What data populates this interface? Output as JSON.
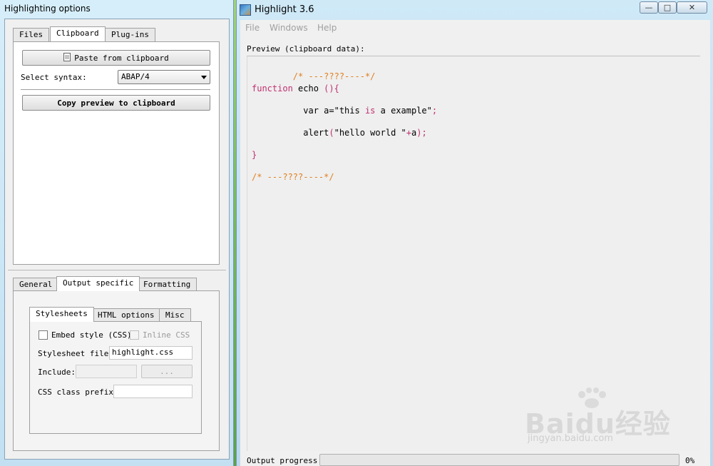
{
  "left_window": {
    "title": "Highlighting options",
    "top_tabs": [
      "Files",
      "Clipboard",
      "Plug-ins"
    ],
    "active_top_tab": "Clipboard",
    "clipboard": {
      "paste_button": "Paste from clipboard",
      "syntax_label": "Select syntax:",
      "syntax_value": "ABAP/4",
      "copy_button": "Copy preview to clipboard"
    },
    "bottom_tabs": [
      "General",
      "Output specific",
      "Formatting"
    ],
    "active_bottom_tab": "Output specific",
    "inner_tabs": [
      "Stylesheets",
      "HTML options",
      "Misc"
    ],
    "active_inner_tab": "Stylesheets",
    "stylesheets": {
      "embed_style_label": "Embed style (CSS)",
      "embed_style_checked": false,
      "inline_css_label": "Inline CSS",
      "inline_css_checked": false,
      "stylesheet_file_label": "Stylesheet file:",
      "stylesheet_file_value": "highlight.css",
      "include_label": "Include:",
      "include_value": "",
      "browse_button": "...",
      "css_prefix_label": "CSS class prefix:",
      "css_prefix_value": ""
    }
  },
  "right_window": {
    "title": "Highlight 3.6",
    "window_buttons": {
      "minimize": "—",
      "maximize": "□",
      "close": "✕"
    },
    "menu": [
      "File",
      "Windows",
      "Help"
    ],
    "preview_label": "Preview (clipboard data):",
    "code": {
      "line1": "/* ---????----*/",
      "line2_kw": "function",
      "line2_name": " echo ",
      "line2_paren": "(){",
      "line3_pre": "          var a=",
      "line3_str": "\"this ",
      "line3_is": "is",
      "line3_rest": " a example\"",
      "line3_end": ";",
      "line4_pre": "          alert",
      "line4_paren": "(",
      "line4_str": "\"hello world \"",
      "line4_plus": "+",
      "line4_a": "a",
      "line4_end": ");",
      "line5": "}",
      "line6": "/* ---????----*/"
    },
    "progress_label": "Output progress:",
    "progress_value": 0,
    "progress_text": "0%"
  },
  "watermark": {
    "text": "Baidu经验",
    "sub": "jingyan.baidu.com"
  },
  "colors": {
    "comment": "#e08020",
    "keyword": "#c03070",
    "progress": "#3fb34f"
  }
}
